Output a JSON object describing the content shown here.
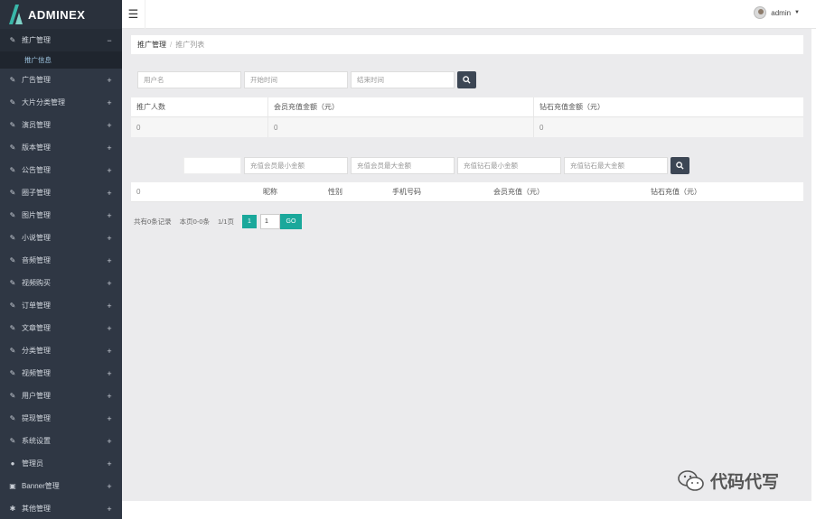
{
  "brand": {
    "name": "ADMINEX"
  },
  "topbar": {
    "username": "admin"
  },
  "sidebar": {
    "items": [
      {
        "icon": "edit-icon",
        "label": "推广管理",
        "mark": "−",
        "active": true
      },
      {
        "icon": "edit-icon",
        "label": "广告管理",
        "mark": "+"
      },
      {
        "icon": "edit-icon",
        "label": "大片分类管理",
        "mark": "+"
      },
      {
        "icon": "edit-icon",
        "label": "演员管理",
        "mark": "+"
      },
      {
        "icon": "edit-icon",
        "label": "版本管理",
        "mark": "+"
      },
      {
        "icon": "edit-icon",
        "label": "公告管理",
        "mark": "+"
      },
      {
        "icon": "edit-icon",
        "label": "圈子管理",
        "mark": "+"
      },
      {
        "icon": "edit-icon",
        "label": "图片管理",
        "mark": "+"
      },
      {
        "icon": "edit-icon",
        "label": "小说管理",
        "mark": "+"
      },
      {
        "icon": "edit-icon",
        "label": "音频管理",
        "mark": "+"
      },
      {
        "icon": "edit-icon",
        "label": "视频购买",
        "mark": "+"
      },
      {
        "icon": "edit-icon",
        "label": "订单管理",
        "mark": "+"
      },
      {
        "icon": "edit-icon",
        "label": "文章管理",
        "mark": "+"
      },
      {
        "icon": "edit-icon",
        "label": "分类管理",
        "mark": "+"
      },
      {
        "icon": "edit-icon",
        "label": "视频管理",
        "mark": "+"
      },
      {
        "icon": "edit-icon",
        "label": "用户管理",
        "mark": "+"
      },
      {
        "icon": "edit-icon",
        "label": "提现管理",
        "mark": "+"
      },
      {
        "icon": "edit-icon",
        "label": "系统设置",
        "mark": "+"
      },
      {
        "icon": "user-icon",
        "label": "管理员",
        "mark": "+"
      },
      {
        "icon": "image-icon",
        "label": "Banner管理",
        "mark": "+"
      },
      {
        "icon": "gear-icon",
        "label": "其他管理",
        "mark": "+"
      }
    ],
    "sub_item": "推广信息"
  },
  "breadcrumb": {
    "current": "推广管理",
    "separator": "/",
    "page": "推广列表"
  },
  "filter1": {
    "username_placeholder": "用户名",
    "start_placeholder": "开始时间",
    "end_placeholder": "结束时间"
  },
  "summary_table": {
    "headers": [
      "推广人数",
      "会员充值金额（元）",
      "钻石充值金额（元）"
    ],
    "values": [
      "0",
      "0",
      "0"
    ]
  },
  "filter2": {
    "placeholders": [
      "充值会员最小金额",
      "充值会员最大金额",
      "充值钻石最小金额",
      "充值钻石最大金额"
    ]
  },
  "detail_table": {
    "lead_value": "0",
    "headers": [
      "昵称",
      "性别",
      "手机号码",
      "会员充值（元）",
      "钻石充值（元）"
    ]
  },
  "pager": {
    "total": "共有0条记录",
    "range": "本页0-0条",
    "pages": "1/1页",
    "current": "1",
    "input_value": "1",
    "go": "GO"
  },
  "watermark": {
    "text": "代码代写"
  },
  "colors": {
    "sidebar": "#2f3744",
    "accent": "#1aa89b",
    "button": "#3c4654",
    "background": "#ebebed"
  }
}
